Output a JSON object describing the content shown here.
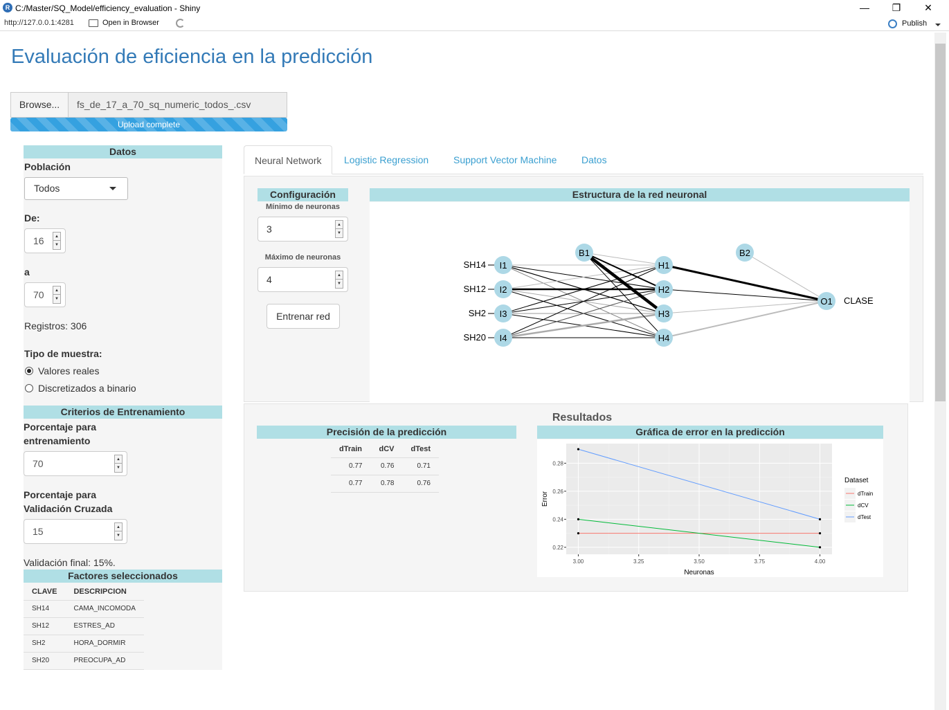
{
  "window": {
    "title": "C:/Master/SQ_Model/efficiency_evaluation - Shiny",
    "url": "http://127.0.0.1:4281",
    "open_in_browser": "Open in Browser",
    "publish": "Publish",
    "minimize": "—",
    "restore": "❐",
    "close": "✕"
  },
  "page": {
    "title": "Evaluación de eficiencia en la predicción"
  },
  "file_input": {
    "browse_label": "Browse...",
    "filename": "fs_de_17_a_70_sq_numeric_todos_.csv",
    "progress_text": "Upload complete",
    "progress": 1.0
  },
  "sidebar": {
    "datos_header": "Datos",
    "poblacion_label": "Población",
    "poblacion_value": "Todos",
    "de_label": "De:",
    "de_value": "16",
    "a_label": "a",
    "a_value": "70",
    "registros": "Registros: 306",
    "tipo_label": "Tipo de muestra:",
    "radio_real": "Valores reales",
    "radio_binario": "Discretizados a binario",
    "criterios_header": "Criterios de Entrenamiento",
    "porc_entrenamiento_label_1": "Porcentaje para",
    "porc_entrenamiento_label_2": "entrenamiento",
    "porc_entrenamiento_value": "70",
    "porc_cv_label_1": "Porcentaje para",
    "porc_cv_label_2": "Validación Cruzada",
    "porc_cv_value": "15",
    "validacion_final": "Validación final: 15%.",
    "factores_header": "Factores seleccionados",
    "factores_columns": [
      "CLAVE",
      "DESCRIPCION"
    ],
    "factores_rows": [
      [
        "SH14",
        "CAMA_INCOMODA"
      ],
      [
        "SH12",
        "ESTRES_AD"
      ],
      [
        "SH2",
        "HORA_DORMIR"
      ],
      [
        "SH20",
        "PREOCUPA_AD"
      ]
    ]
  },
  "tabs": [
    "Neural Network",
    "Logistic Regression",
    "Support Vector Machine",
    "Datos"
  ],
  "config": {
    "header": "Configuración",
    "min_label": "Mínimo de neuronas",
    "min_value": "3",
    "max_label": "Máximo de neuronas",
    "max_value": "4",
    "train_button": "Entrenar red"
  },
  "network": {
    "header": "Estructura de la red neuronal",
    "inputs": [
      {
        "var": "SH14",
        "node": "I1"
      },
      {
        "var": "SH12",
        "node": "I2"
      },
      {
        "var": "SH2",
        "node": "I3"
      },
      {
        "var": "SH20",
        "node": "I4"
      }
    ],
    "hidden": [
      "H1",
      "H2",
      "H3",
      "H4"
    ],
    "bias1": "B1",
    "bias2": "B2",
    "output": "O1",
    "output_label": "CLASE",
    "node_color": "#add8e6"
  },
  "results": {
    "header": "Resultados",
    "precision_header": "Precisión de la predicción",
    "precision_columns": [
      "dTrain",
      "dCV",
      "dTest"
    ],
    "precision_rows": [
      [
        "0.77",
        "0.76",
        "0.71"
      ],
      [
        "0.77",
        "0.78",
        "0.76"
      ]
    ],
    "error_header": "Gráfica de error en la predicción"
  },
  "chart_data": {
    "type": "line",
    "xlabel": "Neuronas",
    "ylabel": "Error",
    "x": [
      3.0,
      4.0
    ],
    "xlim": [
      3.0,
      4.0
    ],
    "ylim": [
      0.22,
      0.29
    ],
    "x_ticks": [
      "3.00",
      "3.25",
      "3.50",
      "3.75",
      "4.00"
    ],
    "y_ticks": [
      "0.22",
      "0.24",
      "0.26",
      "0.28"
    ],
    "legend_title": "Dataset",
    "legend_position": "right",
    "series": [
      {
        "name": "dTrain",
        "values": [
          0.23,
          0.23
        ],
        "color": "#f8766d"
      },
      {
        "name": "dCV",
        "values": [
          0.24,
          0.22
        ],
        "color": "#00ba38"
      },
      {
        "name": "dTest",
        "values": [
          0.29,
          0.24
        ],
        "color": "#619cff"
      }
    ]
  },
  "colors": {
    "accent": "#337ab7",
    "section_header": "#b0dfe5",
    "link": "#3a9fd0"
  }
}
